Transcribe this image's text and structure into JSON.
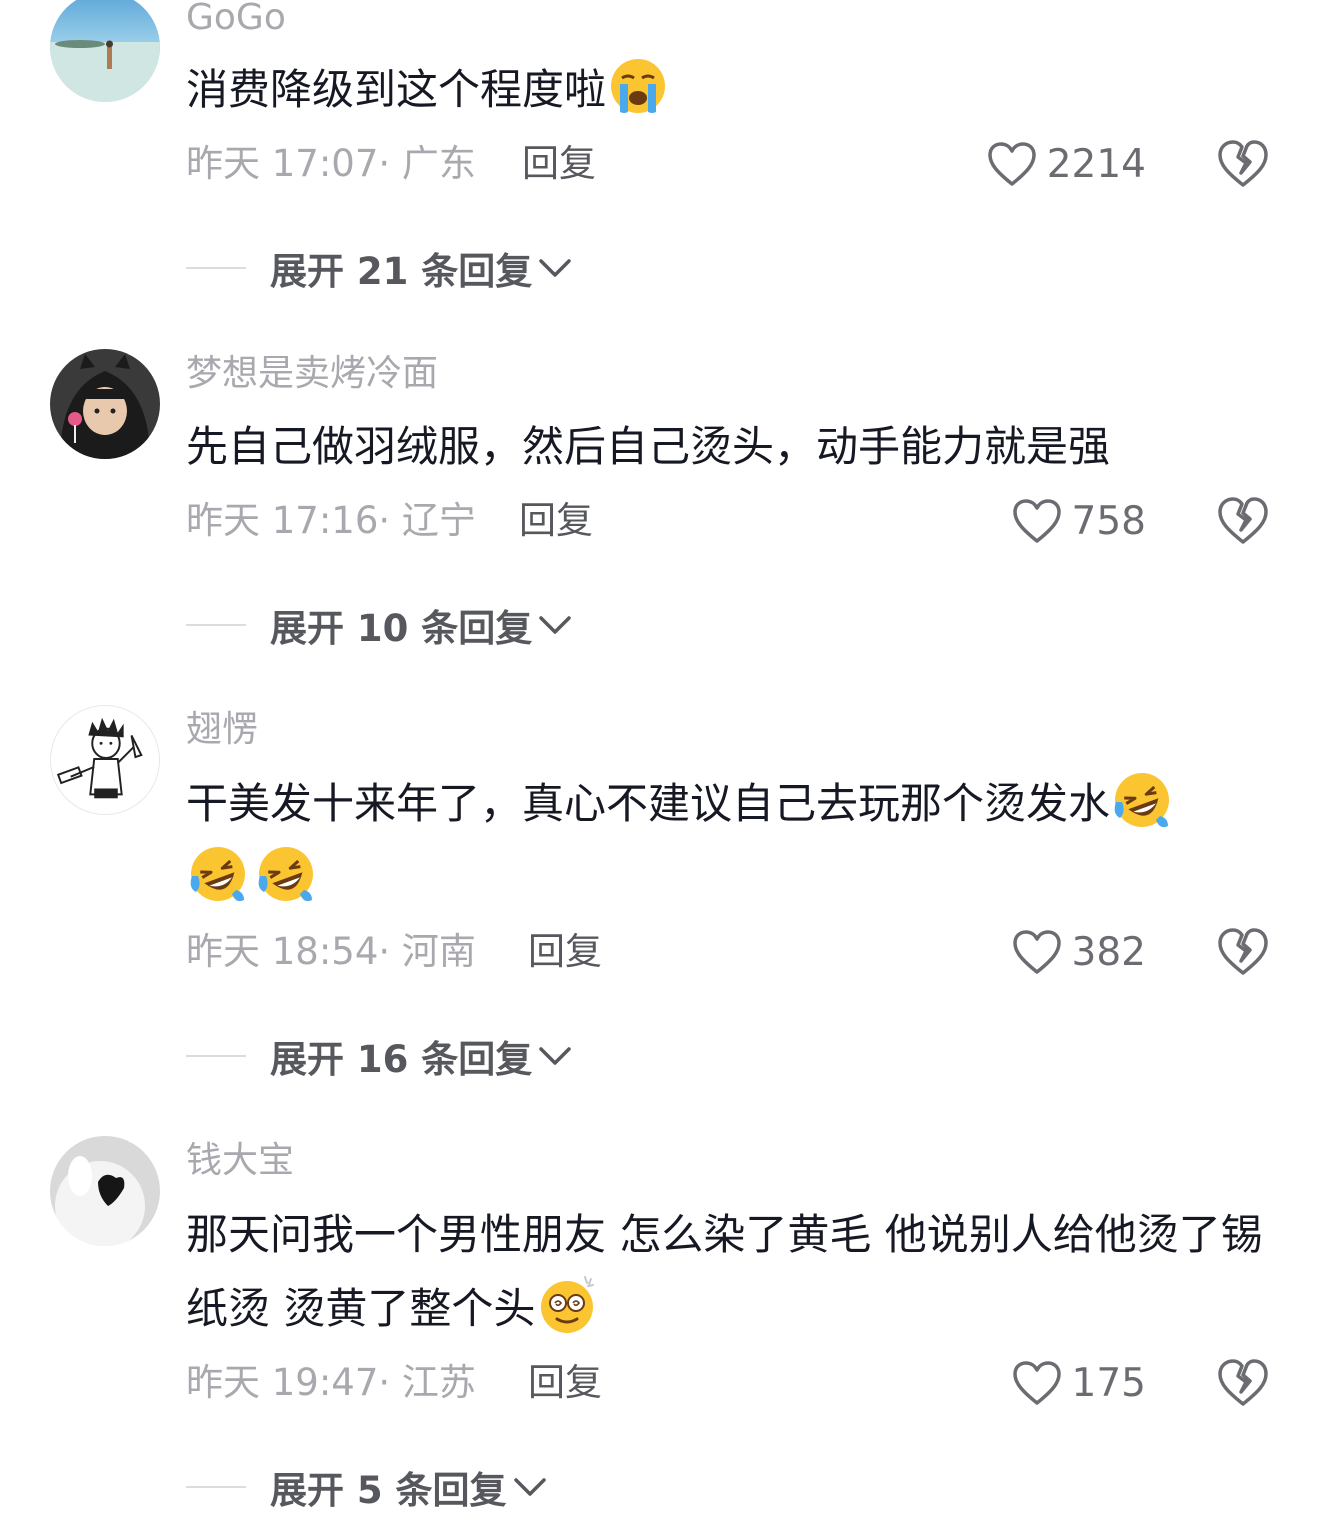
{
  "comments": [
    {
      "username": "GoGo",
      "text": "消费降级到这个程度啦",
      "emoji": "loudly-crying-face",
      "time": "昨天 17:07",
      "location": "· 广东",
      "reply": "回复",
      "likes": "2214",
      "expand": "展开 21 条回复"
    },
    {
      "username": "梦想是卖烤冷面",
      "text": "先自己做羽绒服，然后自己烫头，动手能力就是强",
      "time": "昨天 17:16",
      "location": "· 辽宁",
      "reply": "回复",
      "likes": "758",
      "expand": "展开 10 条回复"
    },
    {
      "username": "翅愣",
      "text": "干美发十来年了，真心不建议自己去玩那个烫发水",
      "emoji": "rolling-on-floor-laughing",
      "time": "昨天 18:54",
      "location": "· 河南",
      "reply": "回复",
      "likes": "382",
      "expand": "展开 16 条回复"
    },
    {
      "username": "钱大宝",
      "text": "那天问我一个男性朋友 怎么染了黄毛 他说别人给他烫了锡纸烫 烫黄了整个头",
      "emoji": "dizzy-face",
      "time": "昨天 19:47",
      "location": "· 江苏",
      "reply": "回复",
      "likes": "175",
      "expand": "展开 5 条回复"
    }
  ],
  "colors": {
    "secondary_text": "#a8a8ae",
    "primary_text": "#161823",
    "action_text": "#57585e"
  }
}
